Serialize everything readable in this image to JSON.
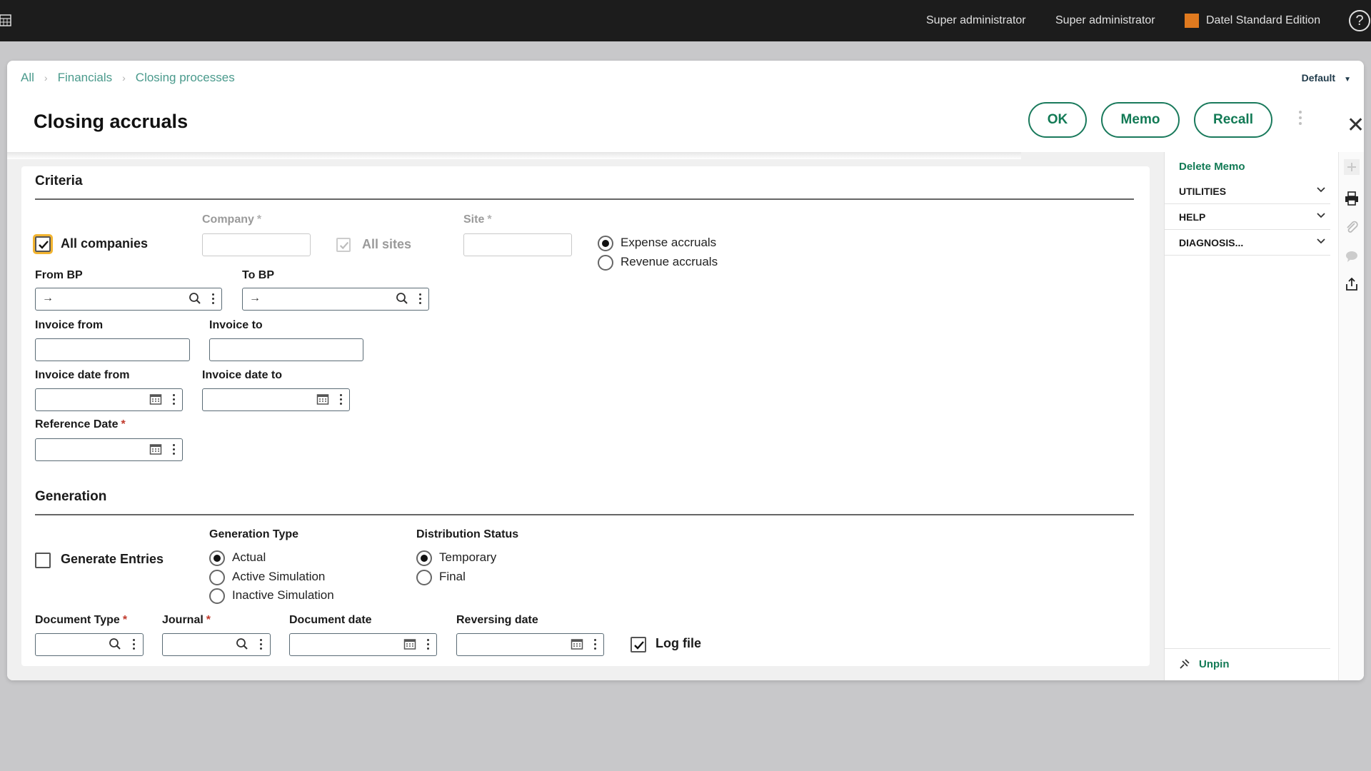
{
  "topbar": {
    "user1": "Super administrator",
    "user2": "Super administrator",
    "edition": "Datel Standard Edition",
    "help_symbol": "?",
    "edition_color": "#e07a1f"
  },
  "breadcrumb": [
    "All",
    "Financials",
    "Closing processes"
  ],
  "breadcrumb_sep": "›",
  "view_selector": "Default",
  "page_title": "Closing accruals",
  "actions": {
    "ok": "OK",
    "memo": "Memo",
    "recall": "Recall",
    "close_symbol": "✕"
  },
  "criteria": {
    "title": "Criteria",
    "all_companies": "All companies",
    "company_label": "Company",
    "all_sites": "All sites",
    "site_label": "Site",
    "accrual_options": [
      "Expense accruals",
      "Revenue accruals"
    ],
    "from_bp": "From BP",
    "to_bp": "To BP",
    "invoice_from": "Invoice from",
    "invoice_to": "Invoice to",
    "invoice_date_from": "Invoice date from",
    "invoice_date_to": "Invoice date to",
    "reference_date": "Reference Date"
  },
  "generation": {
    "title": "Generation",
    "generate_entries": "Generate Entries",
    "generation_type_label": "Generation Type",
    "generation_types": [
      "Actual",
      "Active Simulation",
      "Inactive Simulation"
    ],
    "distribution_status_label": "Distribution Status",
    "distribution_statuses": [
      "Temporary",
      "Final"
    ],
    "document_type": "Document Type",
    "journal": "Journal",
    "document_date": "Document date",
    "reversing_date": "Reversing date",
    "log_file": "Log file"
  },
  "required_mark": "*",
  "side_panel": {
    "delete_memo": "Delete Memo",
    "sections": [
      "UTILITIES",
      "HELP",
      "DIAGNOSIS..."
    ],
    "unpin": "Unpin"
  },
  "colors": {
    "accent_green": "#127a55",
    "topbar_bg": "#1c1c1c",
    "focus_outline": "#f2b430"
  }
}
